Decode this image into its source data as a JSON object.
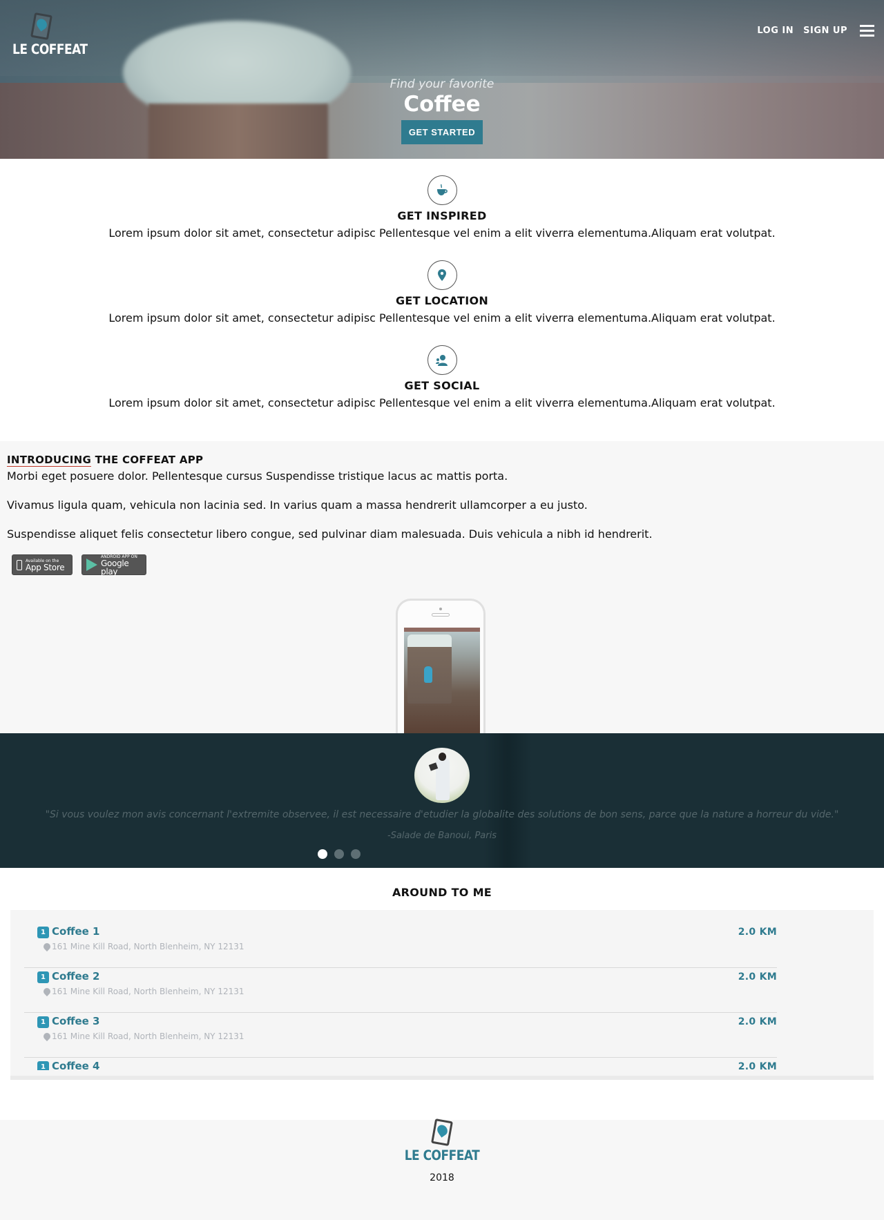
{
  "header": {
    "brand": "LE COFFEAT",
    "nav": {
      "login": "LOG IN",
      "signup": "SIGN UP"
    },
    "hero_subtitle": "Find your favorite",
    "hero_title": "Coffee",
    "cta": "GET STARTED"
  },
  "features": [
    {
      "icon": "coffee-cup-icon",
      "title": "GET INSPIRED",
      "text": "Lorem ipsum dolor sit amet, consectetur adipisc Pellentesque vel enim a elit viverra elementuma.Aliquam erat volutpat."
    },
    {
      "icon": "map-pin-icon",
      "title": "GET LOCATION",
      "text": "Lorem ipsum dolor sit amet, consectetur adipisc Pellentesque vel enim a elit viverra elementuma.Aliquam erat volutpat."
    },
    {
      "icon": "users-icon",
      "title": "GET SOCIAL",
      "text": "Lorem ipsum dolor sit amet, consectetur adipisc Pellentesque vel enim a elit viverra elementuma.Aliquam erat volutpat."
    }
  ],
  "intro": {
    "title_underlined": "INTRODUCING",
    "title_rest": " THE COFFEAT APP",
    "paragraphs": [
      "Morbi eget posuere dolor. Pellentesque cursus Suspendisse tristique lacus ac mattis porta.",
      "Vivamus ligula quam, vehicula non lacinia sed. In varius quam a massa hendrerit ullamcorper a eu justo.",
      "Suspendisse aliquet felis consectetur libero congue, sed pulvinar diam malesuada. Duis vehicula a nibh id hendrerit."
    ],
    "app_store": {
      "small": "Available on the",
      "big": "App Store"
    },
    "google_play": {
      "small": "ANDROID APP ON",
      "big": "Google play"
    }
  },
  "testimonial": {
    "quote": "\"Si vous voulez mon avis concernant l'extremite observee, il est necessaire d'etudier la globalite des solutions de bon sens, parce que la nature a horreur du vide.\"",
    "author": "-Salade de Banoui, Paris",
    "slides": 3,
    "active_slide": 1
  },
  "around": {
    "title": "AROUND TO ME",
    "items": [
      {
        "badge": "1",
        "name": "Coffee 1",
        "address": "161 Mine Kill Road, North Blenheim, NY 12131",
        "distance": "2.0 KM"
      },
      {
        "badge": "1",
        "name": "Coffee 2",
        "address": "161 Mine Kill Road, North Blenheim, NY 12131",
        "distance": "2.0 KM"
      },
      {
        "badge": "1",
        "name": "Coffee 3",
        "address": "161 Mine Kill Road, North Blenheim, NY 12131",
        "distance": "2.0 KM"
      },
      {
        "badge": "1",
        "name": "Coffee 4",
        "address": "",
        "distance": "2.0 KM"
      }
    ]
  },
  "footer": {
    "brand": "LE COFFEAT",
    "year": "2018"
  },
  "colors": {
    "accent": "#2f7b8f",
    "badge": "#2e96b5",
    "underline": "#c0392b",
    "testimonial_bg": "#1a2f36"
  }
}
